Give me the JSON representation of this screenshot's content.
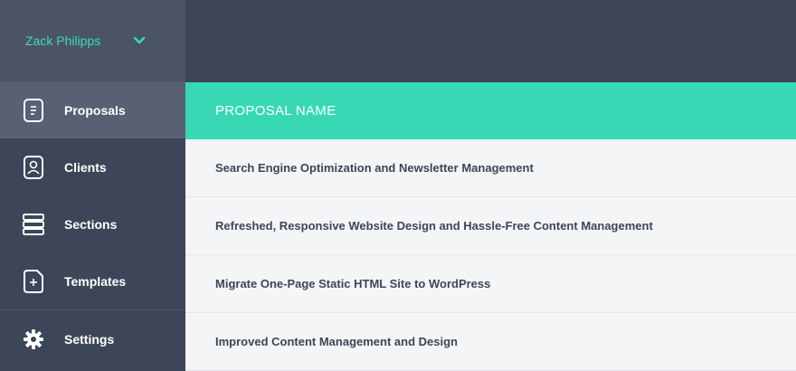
{
  "user": {
    "name": "Zack Philipps"
  },
  "nav": [
    {
      "label": "Proposals",
      "icon": "proposal-icon",
      "active": true
    },
    {
      "label": "Clients",
      "icon": "client-icon"
    },
    {
      "label": "Sections",
      "icon": "sections-icon"
    },
    {
      "label": "Templates",
      "icon": "template-icon"
    },
    {
      "label": "Settings",
      "icon": "gear-icon"
    }
  ],
  "table": {
    "header": "PROPOSAL NAME",
    "rows": [
      "Search Engine Optimization and Newsletter Management",
      "Refreshed, Responsive Website Design and Hassle-Free Content Management",
      "Migrate One-Page Static HTML Site to WordPress",
      "Improved Content Management and Design"
    ]
  },
  "colors": {
    "accent": "#38d8b4",
    "sidebar": "#3d4658",
    "active_item": "#586174"
  }
}
